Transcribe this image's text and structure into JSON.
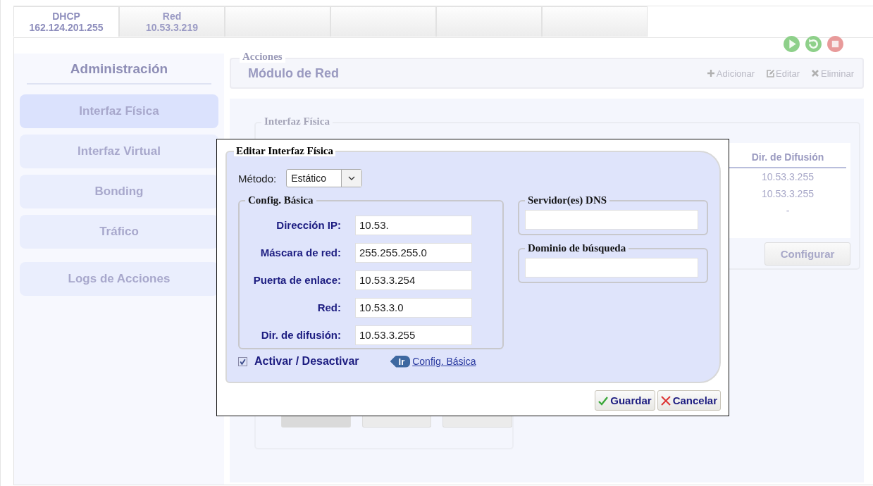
{
  "tabs": [
    {
      "title": "DHCP",
      "ip": "162.124.201.255",
      "selected": true
    },
    {
      "title": "Red",
      "ip": "10.53.3.219",
      "selected": false
    }
  ],
  "sidebar": {
    "title": "Administración",
    "items": [
      {
        "label": "Interfaz Física",
        "selected": true
      },
      {
        "label": "Interfaz Virtual",
        "selected": false
      },
      {
        "label": "Bonding",
        "selected": false
      },
      {
        "label": "Tráfico",
        "selected": false
      },
      {
        "label": "Logs de Acciones",
        "selected": false
      }
    ]
  },
  "actions": {
    "legend": "Acciones",
    "title": "Módulo de Red",
    "buttons": [
      {
        "kind": "add",
        "label": "Adicionar"
      },
      {
        "kind": "edit",
        "label": "Editar"
      },
      {
        "kind": "delete",
        "label": "Eliminar"
      }
    ]
  },
  "panel": {
    "legend": "Interfaz Física",
    "column": "Dir. de Difusión",
    "cells": [
      "10.53.3.255",
      "10.53.3.255",
      "-"
    ],
    "configure_button": "Configurar"
  },
  "dialog": {
    "legend": "Editar Interfaz Física",
    "method": {
      "label": "Método:",
      "value": "Estático"
    },
    "basic": {
      "legend": "Config. Básica",
      "fields": [
        {
          "label": "Dirección IP:",
          "value": "10.53."
        },
        {
          "label": "Máscara de red:",
          "value": "255.255.255.0"
        },
        {
          "label": "Puerta de enlace:",
          "value": "10.53.3.254"
        },
        {
          "label": "Red:",
          "value": "10.53.3.0"
        },
        {
          "label": "Dir. de difusión:",
          "value": "10.53.3.255"
        }
      ]
    },
    "dns": {
      "legend": "Servidor(es) DNS"
    },
    "search_domain": {
      "legend": "Dominio de búsqueda"
    },
    "activate": {
      "label": "Activar / Desactivar",
      "checked": true
    },
    "go": {
      "badge": "Ir",
      "link": "Config. Básica"
    },
    "buttons": [
      {
        "kind": "save",
        "label": "Guardar"
      },
      {
        "kind": "cancel",
        "label": "Cancelar"
      }
    ]
  }
}
